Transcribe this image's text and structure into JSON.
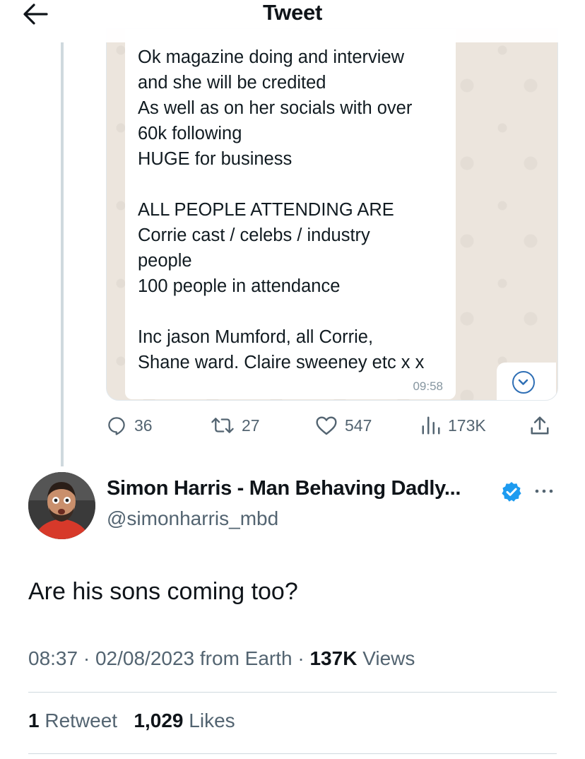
{
  "header": {
    "title": "Tweet",
    "back_icon": "arrow-left-icon"
  },
  "quoted_image": {
    "lines_block1": "Ok magazine doing and interview\nand she will be credited\nAs well as on her socials with over\n60k following\nHUGE for business",
    "lines_block2": "ALL PEOPLE ATTENDING ARE\nCorrie cast / celebs / industry\npeople\n100 people in attendance",
    "lines_block3": "Inc jason Mumford, all Corrie,\nShane ward. Claire sweeney etc x x",
    "time": "09:58"
  },
  "parent_actions": {
    "replies": "36",
    "retweets": "27",
    "likes": "547",
    "views": "173K"
  },
  "author": {
    "name": "Simon Harris - Man Behaving Dadly...",
    "handle": "@simonharris_mbd",
    "verified": true
  },
  "tweet": {
    "text": "Are his sons coming too?",
    "time": "08:37",
    "date": "02/08/2023",
    "source": "from Earth",
    "views_count": "137K",
    "views_label": "Views"
  },
  "stats": {
    "retweets_count": "1",
    "retweets_label": "Retweet",
    "likes_count": "1,029",
    "likes_label": "Likes"
  },
  "colors": {
    "text": "#0f1419",
    "secondary": "#536471",
    "verified": "#1d9bf0",
    "divider": "#cfd9de"
  }
}
